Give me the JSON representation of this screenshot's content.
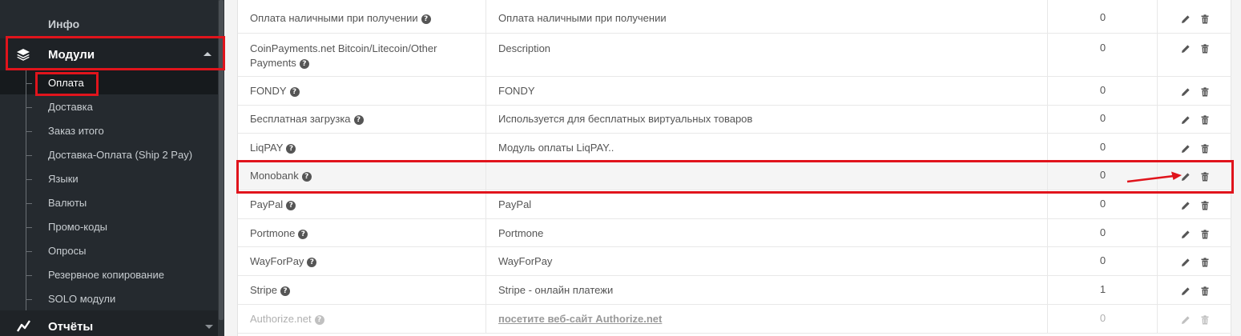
{
  "sidebar": {
    "top_item": "Инфо",
    "modules": {
      "label": "Модули",
      "icon": "layers-icon"
    },
    "submenu": [
      {
        "label": "Оплата",
        "active": true
      },
      {
        "label": "Доставка"
      },
      {
        "label": "Заказ итого"
      },
      {
        "label": "Доставка-Оплата (Ship 2 Pay)"
      },
      {
        "label": "Языки"
      },
      {
        "label": "Валюты"
      },
      {
        "label": "Промо-коды"
      },
      {
        "label": "Опросы"
      },
      {
        "label": "Резервное копирование"
      },
      {
        "label": "SOLO модули"
      }
    ],
    "reports": {
      "label": "Отчёты",
      "icon": "chart-icon"
    }
  },
  "payments": {
    "rows": [
      {
        "name": "Оплата наличными при получении",
        "description": "Оплата наличными при получении",
        "sort_order": "0"
      },
      {
        "name": "CoinPayments.net Bitcoin/Litecoin/Other Payments",
        "description": "Description",
        "sort_order": "0"
      },
      {
        "name": "FONDY",
        "description": "FONDY",
        "sort_order": "0"
      },
      {
        "name": "Бесплатная загрузка",
        "description": "Используется для бесплатных виртуальных товаров",
        "sort_order": "0"
      },
      {
        "name": "LiqPAY",
        "description": "Модуль оплаты LiqPAY..",
        "sort_order": "0"
      },
      {
        "name": "Monobank",
        "description": "",
        "sort_order": "0"
      },
      {
        "name": "PayPal",
        "description": "PayPal",
        "sort_order": "0"
      },
      {
        "name": "Portmone",
        "description": "Portmone",
        "sort_order": "0"
      },
      {
        "name": "WayForPay",
        "description": "WayForPay",
        "sort_order": "0"
      },
      {
        "name": "Stripe",
        "description": "Stripe - онлайн платежи",
        "sort_order": "1"
      },
      {
        "name": "Authorize.net",
        "description": "посетите веб-сайт Authorize.net",
        "sort_order": "0"
      }
    ],
    "help_glyph": "?",
    "action_icons": [
      "pencil-icon",
      "trash-icon"
    ]
  },
  "colors": {
    "highlight": "#e0141c",
    "sidebar_bg": "#252a2f"
  }
}
